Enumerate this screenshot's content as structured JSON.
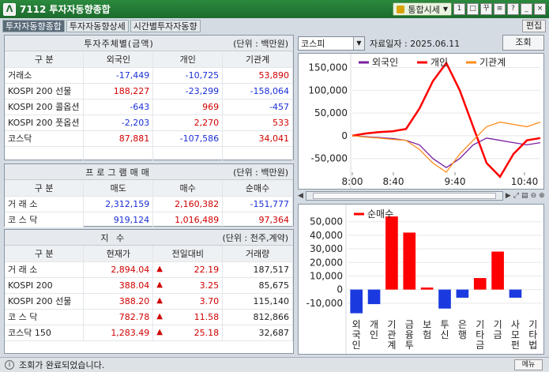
{
  "titlebar": {
    "code": "7112",
    "title": "투자자동향종합",
    "lock_label": "통합시세",
    "buttons": [
      "1",
      "□",
      "꾸",
      "≡",
      "?",
      "_",
      "×"
    ]
  },
  "tabs": [
    "투자자동향종합",
    "투자자동향상세",
    "시간별투자자동향"
  ],
  "edit_label": "편집",
  "investor_panel": {
    "caption": "투자주체별(금액)",
    "unit": "(단위 : 백만원)",
    "headers": [
      "구 분",
      "외국인",
      "개인",
      "기관계"
    ],
    "rows": [
      {
        "label": "거래소",
        "foreign": "-17,449",
        "individual": "-10,725",
        "institution": "53,890"
      },
      {
        "label": "KOSPI 200 선물",
        "foreign": "188,227",
        "individual": "-23,299",
        "institution": "-158,064"
      },
      {
        "label": "KOSPI 200 콜옵션",
        "foreign": "-643",
        "individual": "969",
        "institution": "-457"
      },
      {
        "label": "KOSPI 200 풋옵션",
        "foreign": "-2,203",
        "individual": "2,270",
        "institution": "533"
      },
      {
        "label": "코스닥",
        "foreign": "87,881",
        "individual": "-107,586",
        "institution": "34,041"
      }
    ]
  },
  "program_panel": {
    "caption": "프로그램매매",
    "unit": "(단위 : 백만원)",
    "headers": [
      "구 분",
      "매도",
      "매수",
      "순매수"
    ],
    "rows": [
      {
        "label": "거 래 소",
        "sell": "2,312,159",
        "buy": "2,160,382",
        "net": "-151,777"
      },
      {
        "label": "코 스 닥",
        "sell": "919,124",
        "buy": "1,016,489",
        "net": "97,364"
      }
    ]
  },
  "index_panel": {
    "caption": "지 수",
    "unit": "(단위 : 천주,계약)",
    "headers": [
      "구 분",
      "현재가",
      "전일대비",
      "거래량"
    ],
    "rows": [
      {
        "label": "거 래 소",
        "price": "2,894.04",
        "change": "22.19",
        "volume": "187,517"
      },
      {
        "label": "KOSPI 200",
        "price": "388.04",
        "change": "3.25",
        "volume": "85,675"
      },
      {
        "label": "KOSPI 200 선물",
        "price": "388.20",
        "change": "3.70",
        "volume": "115,140"
      },
      {
        "label": "코 스 닥",
        "price": "782.78",
        "change": "11.58",
        "volume": "812,866"
      },
      {
        "label": "코스닥 150",
        "price": "1,283.49",
        "change": "25.18",
        "volume": "32,687"
      }
    ]
  },
  "controls": {
    "market": "코스피",
    "date_label": "자료일자 : 2025.06.11",
    "search_label": "조회"
  },
  "status_text": "조회가 완료되었습니다.",
  "menu_label": "메뉴",
  "chart_data": [
    {
      "type": "line",
      "x_ticks": [
        "8:00",
        "8:40",
        "9:40",
        "10:40"
      ],
      "y_ticks": [
        "150,000",
        "100,000",
        "50,000",
        "0",
        "-50,000"
      ],
      "ylim": [
        -80000,
        170000
      ],
      "series": [
        {
          "name": "외국인",
          "color": "#7a1fa2",
          "values": [
            0,
            -2000,
            -4000,
            -6000,
            -10000,
            -20000,
            -50000,
            -70000,
            -50000,
            -20000,
            -5000,
            -10000,
            -15000,
            -20000,
            -15000
          ]
        },
        {
          "name": "개인",
          "color": "#ff0000",
          "values": [
            0,
            5000,
            8000,
            10000,
            15000,
            60000,
            120000,
            160000,
            100000,
            20000,
            -60000,
            -90000,
            -40000,
            -10000,
            -5000
          ]
        },
        {
          "name": "기관계",
          "color": "#ff8c1a",
          "values": [
            0,
            -3000,
            -5000,
            -8000,
            -10000,
            -30000,
            -60000,
            -80000,
            -40000,
            -10000,
            20000,
            30000,
            25000,
            20000,
            30000
          ]
        }
      ]
    },
    {
      "type": "bar",
      "legend": "순매수",
      "categories": [
        "외국인",
        "개인",
        "기관계",
        "금융투",
        "보험",
        "투신",
        "은행",
        "기타금",
        "기금",
        "사모펀",
        "기타법"
      ],
      "values": [
        -17449,
        -10725,
        53890,
        42000,
        1500,
        -14000,
        -6000,
        8500,
        28000,
        -6000,
        0
      ],
      "y_ticks": [
        "50,000",
        "40,000",
        "30,000",
        "20,000",
        "10,000",
        "0",
        "-10,000"
      ],
      "ylim": [
        -20000,
        58000
      ],
      "pos_color": "#ff0000",
      "neg_color": "#1a3adf"
    }
  ]
}
